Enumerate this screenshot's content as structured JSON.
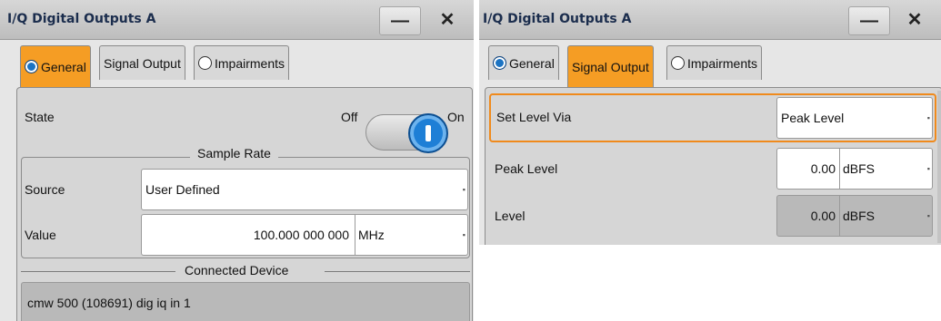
{
  "dialogA": {
    "title": "I/Q Digital Outputs A",
    "minimize_label": "—",
    "close_label": "✕",
    "tabs": [
      "General",
      "Signal Output",
      "Impairments"
    ],
    "state_label": "State",
    "toggle_off": "Off",
    "toggle_on": "On",
    "sample_rate_title": "Sample Rate",
    "source_label": "Source",
    "source_value": "User Defined",
    "value_label": "Value",
    "value_number": "100.000 000 000",
    "value_unit": "MHz",
    "connected_device_title": "Connected Device",
    "connected_device_value": "cmw 500 (108691) dig iq in 1"
  },
  "dialogB": {
    "title": "I/Q Digital Outputs A",
    "minimize_label": "—",
    "close_label": "✕",
    "tabs": [
      "General",
      "Signal Output",
      "Impairments"
    ],
    "set_level_via_label": "Set Level Via",
    "set_level_via_value": "Peak Level",
    "peak_level_label": "Peak Level",
    "peak_level_value": "0.00",
    "peak_level_unit": "dBFS",
    "level_label": "Level",
    "level_value": "0.00",
    "level_unit": "dBFS"
  },
  "colors": {
    "active_tab": "#f59d24",
    "toggle_knob": "#1e7fd6",
    "focus_border": "#f08a1c"
  }
}
